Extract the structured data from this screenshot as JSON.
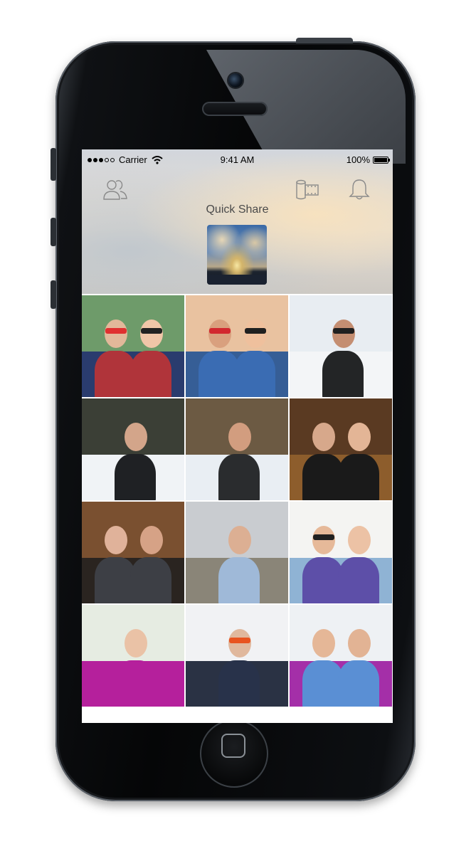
{
  "status_bar": {
    "signal_dots": [
      true,
      true,
      true,
      false,
      false
    ],
    "carrier": "Carrier",
    "time": "9:41 AM",
    "battery": "100%",
    "battery_level": 1.0
  },
  "header": {
    "title": "Quick Share",
    "left_icon": "people-icon",
    "middle_icon": "film-roll-icon",
    "right_icon": "bell-icon"
  },
  "photos": [
    {
      "name": "photo-friends-sunglasses",
      "sky": "#6e9b6a",
      "ground": "#2a3c6e",
      "heads": [
        "#e2b89a",
        "#f0c6a8"
      ],
      "shades": [
        "#e03030",
        "#222222"
      ],
      "body": "#b0343a"
    },
    {
      "name": "photo-festival-crowd",
      "sky": "#e9c2a0",
      "ground": "#365e96",
      "heads": [
        "#d9a07e",
        "#efc09d"
      ],
      "shades": [
        "#d2282f",
        "#202020"
      ],
      "body": "#3a6cb3"
    },
    {
      "name": "photo-snow-sledding-1",
      "sky": "#e8edf2",
      "ground": "#f3f5f7",
      "heads": [
        "#c48e72"
      ],
      "shades": [
        "#202020"
      ],
      "body": "#232526"
    },
    {
      "name": "photo-snow-sitting",
      "sky": "#3b3f36",
      "ground": "#f0f3f6",
      "heads": [
        "#d3a58a"
      ],
      "shades": [],
      "body": "#1f2124"
    },
    {
      "name": "photo-snow-sledding-2",
      "sky": "#6c5a43",
      "ground": "#e9eef3",
      "heads": [
        "#d29d7f"
      ],
      "shades": [],
      "body": "#2a2c2e"
    },
    {
      "name": "photo-couple-party",
      "sky": "#5a3a22",
      "ground": "#8d5d2c",
      "heads": [
        "#d7a88b",
        "#e3b596"
      ],
      "shades": [],
      "body": "#1a1a1a"
    },
    {
      "name": "photo-couple-restaurant",
      "sky": "#7a5030",
      "ground": "#2a2420",
      "heads": [
        "#e0b29a",
        "#d6a286"
      ],
      "shades": [],
      "body": "#3d3f45"
    },
    {
      "name": "photo-pizza",
      "sky": "#c9ccd0",
      "ground": "#8a8578",
      "heads": [
        "#dcaf93"
      ],
      "shades": [],
      "body": "#9fb9d8"
    },
    {
      "name": "photo-couple-selfie",
      "sky": "#f4f4f2",
      "ground": "#8fb3d4",
      "heads": [
        "#e6b999",
        "#ecc2a5"
      ],
      "shades": [
        "#202020"
      ],
      "body": "#5d4fa8"
    },
    {
      "name": "photo-woman-purple-dress",
      "sky": "#e6ece2",
      "ground": "#b5209c",
      "heads": [
        "#eac2a6"
      ],
      "shades": [],
      "body": "#b5209c"
    },
    {
      "name": "photo-man-orange-sunglasses",
      "sky": "#f1f2f4",
      "ground": "#2a3244",
      "heads": [
        "#e0b89d"
      ],
      "shades": [
        "#e8531f"
      ],
      "body": "#28324a"
    },
    {
      "name": "photo-wedding-guests",
      "sky": "#eef1f4",
      "ground": "#a42fa8",
      "heads": [
        "#e5b797",
        "#e2b394"
      ],
      "shades": [],
      "body": "#5a8fd4"
    }
  ]
}
